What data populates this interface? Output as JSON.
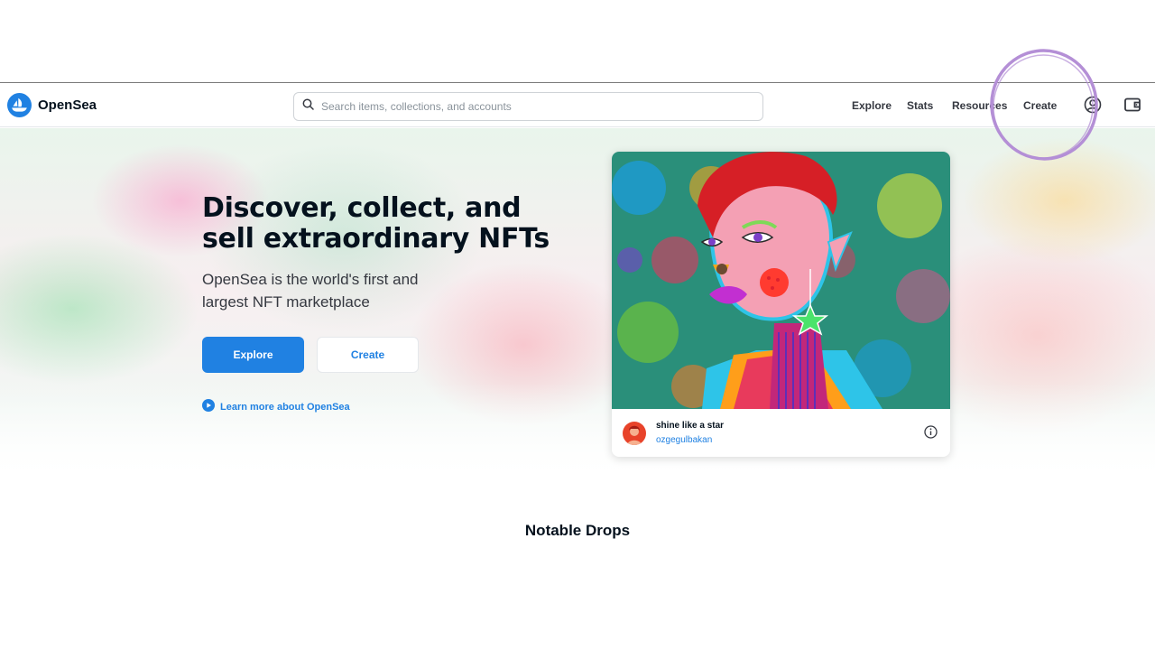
{
  "brand": {
    "name": "OpenSea",
    "color": "#2081e2"
  },
  "search": {
    "placeholder": "Search items, collections, and accounts"
  },
  "nav": {
    "links": [
      {
        "label": "Explore"
      },
      {
        "label": "Stats"
      },
      {
        "label": "Resources"
      },
      {
        "label": "Create"
      }
    ],
    "icons": [
      "account-icon",
      "wallet-icon"
    ]
  },
  "hero": {
    "title": "Discover, collect, and sell extraordinary NFTs",
    "subtitle": "OpenSea is the world's first and largest NFT marketplace",
    "primary_button": "Explore",
    "secondary_button": "Create",
    "learn_more": "Learn more about OpenSea"
  },
  "featured": {
    "title": "shine like a star",
    "creator": "ozgegulbakan"
  },
  "sections": {
    "notable_drops": "Notable Drops"
  },
  "colors": {
    "accent": "#2081e2",
    "annotation_circle": "#b48fd6",
    "text": "#04111d"
  }
}
